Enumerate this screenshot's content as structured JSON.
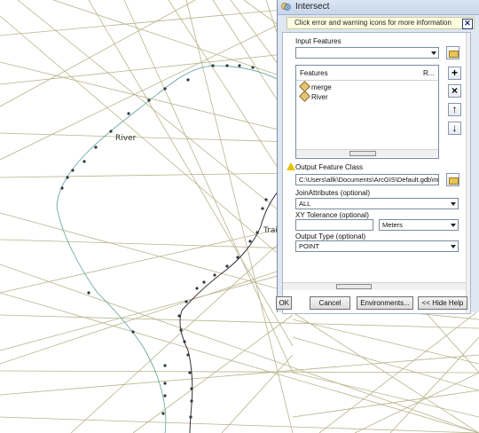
{
  "map": {
    "labels": {
      "river": "River",
      "trail": "Trail"
    }
  },
  "dialog": {
    "title": "Intersect",
    "message": "Click error and warning icons for more information",
    "close_glyph": "✕",
    "input_features": {
      "label": "Input Features",
      "value": "",
      "table_header": {
        "features": "Features",
        "rank": "R..."
      },
      "items": [
        "merge",
        "River"
      ]
    },
    "list_buttons": {
      "add": "+",
      "remove": "×",
      "up": "↑",
      "down": "↓"
    },
    "output_feature_class": {
      "label": "Output Feature Class",
      "value": "C:\\Users\\allk\\Documents\\ArcGIS\\Default.gdb\\me"
    },
    "join_attributes": {
      "label": "JoinAttributes (optional)",
      "value": "ALL"
    },
    "xy_tolerance": {
      "label": "XY Tolerance (optional)",
      "value": "",
      "unit": "Meters"
    },
    "output_type": {
      "label": "Output Type (optional)",
      "value": "POINT"
    },
    "buttons": {
      "ok": "OK",
      "cancel": "Cancel",
      "environments": "Environments...",
      "hide_help": "<< Hide Help"
    }
  },
  "colors": {
    "line": "#b8b48a",
    "river": "#5b9f9b",
    "trail": "#3b3040",
    "dialog_bg": "#dee7f2"
  }
}
